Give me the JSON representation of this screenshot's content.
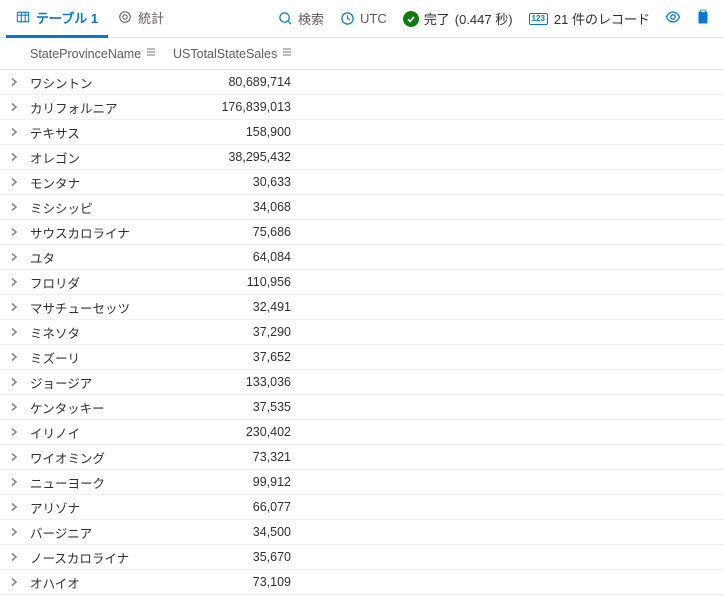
{
  "toolbar": {
    "tab_table": "テーブル 1",
    "tab_stats": "統計",
    "search": "検索",
    "utc": "UTC",
    "done": "完了",
    "done_time": "(0.447 秒)",
    "records": "21 件のレコード"
  },
  "columns": {
    "c1": "StateProvinceName",
    "c2": "USTotalStateSales"
  },
  "rows": [
    {
      "name": "ワシントン",
      "val": "80,689,714"
    },
    {
      "name": "カリフォルニア",
      "val": "176,839,013"
    },
    {
      "name": "テキサス",
      "val": "158,900"
    },
    {
      "name": "オレゴン",
      "val": "38,295,432"
    },
    {
      "name": "モンタナ",
      "val": "30,633"
    },
    {
      "name": "ミシシッピ",
      "val": "34,068"
    },
    {
      "name": "サウスカロライナ",
      "val": "75,686"
    },
    {
      "name": "ユタ",
      "val": "64,084"
    },
    {
      "name": "フロリダ",
      "val": "110,956"
    },
    {
      "name": "マサチューセッツ",
      "val": "32,491"
    },
    {
      "name": "ミネソタ",
      "val": "37,290"
    },
    {
      "name": "ミズーリ",
      "val": "37,652"
    },
    {
      "name": "ジョージア",
      "val": "133,036"
    },
    {
      "name": "ケンタッキー",
      "val": "37,535"
    },
    {
      "name": "イリノイ",
      "val": "230,402"
    },
    {
      "name": "ワイオミング",
      "val": "73,321"
    },
    {
      "name": "ニューヨーク",
      "val": "99,912"
    },
    {
      "name": "アリゾナ",
      "val": "66,077"
    },
    {
      "name": "バージニア",
      "val": "34,500"
    },
    {
      "name": "ノースカロライナ",
      "val": "35,670"
    },
    {
      "name": "オハイオ",
      "val": "73,109"
    }
  ]
}
